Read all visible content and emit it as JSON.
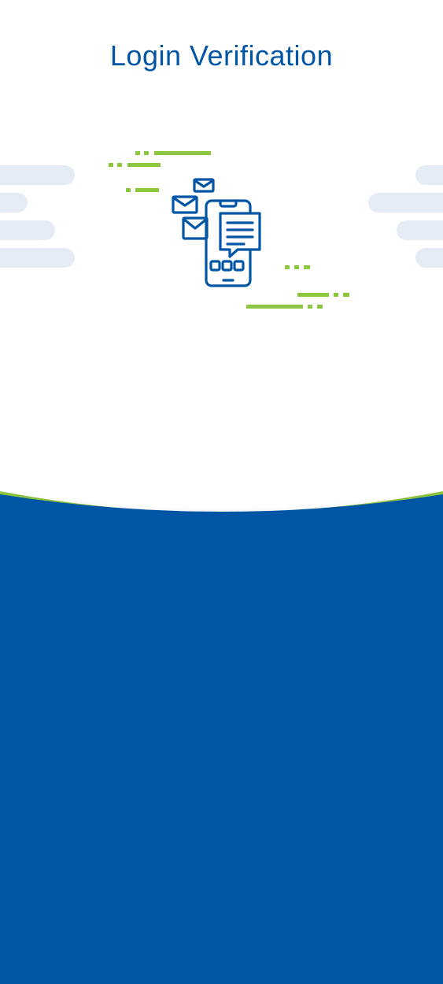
{
  "header": {
    "title": "Login Verification"
  },
  "illustration": {
    "icon": "phone-messages-icon"
  },
  "colors": {
    "primary_blue": "#0055a5",
    "accent_green": "#8dc63f",
    "pill_gray": "#e5ecf5",
    "background": "#ffffff"
  }
}
